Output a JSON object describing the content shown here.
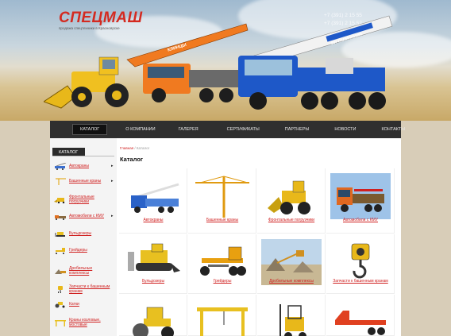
{
  "logo": {
    "title": "СПЕЦМАШ",
    "tagline": "продажа спецтехники в Красноярске"
  },
  "phones": [
    "+7 (391) 2 15 55",
    "+7 (391) 2 15 52"
  ],
  "crane_labels": [
    "КЛИНЦЫ",
    "50т  ГАЛИЧАНИН"
  ],
  "nav": {
    "items": [
      "КАТАЛОГ",
      "О КОМПАНИИ",
      "ГАЛЕРЕЯ",
      "СЕРТИФИКАТЫ",
      "ПАРТНЕРЫ",
      "НОВОСТИ",
      "КОНТАКТЫ"
    ]
  },
  "sidebar": {
    "heading": "КАТАЛОГ",
    "items": [
      {
        "label": "Автокраны",
        "has_submenu": true
      },
      {
        "label": "Башенные краны",
        "has_submenu": true
      },
      {
        "label": "Фронтальные погрузчики",
        "has_submenu": false
      },
      {
        "label": "Автомобили с КМУ",
        "has_submenu": true
      },
      {
        "label": "Бульдозеры",
        "has_submenu": false
      },
      {
        "label": "Грейдеры",
        "has_submenu": false
      },
      {
        "label": "Дробильные комплексы",
        "has_submenu": false
      },
      {
        "label": "Запчасти к башенным кранам",
        "has_submenu": false
      },
      {
        "label": "Катки",
        "has_submenu": false
      },
      {
        "label": "Краны козловые, мостовые",
        "has_submenu": false
      }
    ]
  },
  "breadcrumb": {
    "home": "Главная",
    "current": "Каталог"
  },
  "page_title": "Каталог",
  "catalog": [
    {
      "label": "Автокраны",
      "icon": "truck-crane-icon"
    },
    {
      "label": "Башенные краны",
      "icon": "tower-crane-icon"
    },
    {
      "label": "Фронтальные погрузчики",
      "icon": "front-loader-icon"
    },
    {
      "label": "Автомобили с КМУ",
      "icon": "kmu-truck-icon"
    },
    {
      "label": "Бульдозеры",
      "icon": "bulldozer-icon"
    },
    {
      "label": "Грейдеры",
      "icon": "grader-icon"
    },
    {
      "label": "Дробильные комплексы",
      "icon": "crushing-plant-icon"
    },
    {
      "label": "Запчасти к башенным кранам",
      "icon": "crane-hook-icon"
    },
    {
      "label": "",
      "icon": "road-roller-icon"
    },
    {
      "label": "",
      "icon": "gantry-crane-icon"
    },
    {
      "label": "",
      "icon": "forklift-icon"
    },
    {
      "label": "",
      "icon": "lowbed-trailer-icon"
    }
  ],
  "colors": {
    "accent_red": "#d02020",
    "nav_bg": "#2f2f2f",
    "logo_red": "#d42a20"
  }
}
